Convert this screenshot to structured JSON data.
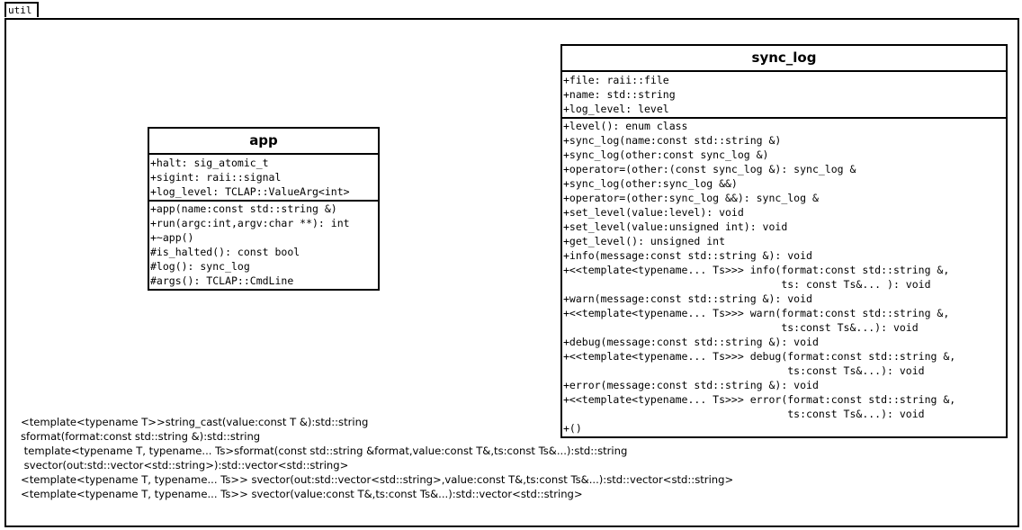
{
  "package": {
    "name": "util"
  },
  "classes": {
    "app": {
      "name": "app",
      "attributes": [
        "+halt: sig_atomic_t",
        "+sigint: raii::signal",
        "+log_level: TCLAP::ValueArg<int>"
      ],
      "operations": [
        "+app(name:const std::string &)",
        "+run(argc:int,argv:char **): int",
        "+~app()",
        "#is_halted(): const bool",
        "#log(): sync_log",
        "#args(): TCLAP::CmdLine"
      ]
    },
    "sync_log": {
      "name": "sync_log",
      "attributes": [
        "+file: raii::file",
        "+name: std::string",
        "+log_level: level"
      ],
      "operations": [
        "+level(): enum class",
        "+sync_log(name:const std::string &)",
        "+sync_log(other:const sync_log &)",
        "+operator=(other:(const sync_log &): sync_log &",
        "+sync_log(other:sync_log &&)",
        "+operator=(other:sync_log &&): sync_log &",
        "+set_level(value:level): void",
        "+set_level(value:unsigned int): void",
        "+get_level(): unsigned int",
        "+info(message:const std::string &): void",
        "+<<template<typename... Ts>>> info(format:const std::string &,",
        "                                   ts: const Ts&... ): void",
        "+warn(message:const std::string &): void",
        "+<<template<typename... Ts>>> warn(format:const std::string &,",
        "                                   ts:const Ts&...): void",
        "+debug(message:const std::string &): void",
        "+<<template<typename... Ts>>> debug(format:const std::string &,",
        "                                    ts:const Ts&...): void",
        "+error(message:const std::string &): void",
        "+<<template<typename... Ts>>> error(format:const std::string &,",
        "                                    ts:const Ts&...): void",
        "+()"
      ]
    }
  },
  "free_functions": [
    "<template<typename T>>string_cast(value:const T &):std::string",
    "sformat(format:const std::string &):std::string",
    " template<typename T, typename... Ts>sformat(const std::string &format,value:const T&,ts:const Ts&...):std::string",
    " svector(out:std::vector<std::string>):std::vector<std::string>",
    "<template<typename T, typename... Ts>> svector(out:std::vector<std::string>,value:const T&,ts:const Ts&...):std::vector<std::string>",
    "<template<typename T, typename... Ts>> svector(value:const T&,ts:const Ts&...):std::vector<std::string>"
  ]
}
